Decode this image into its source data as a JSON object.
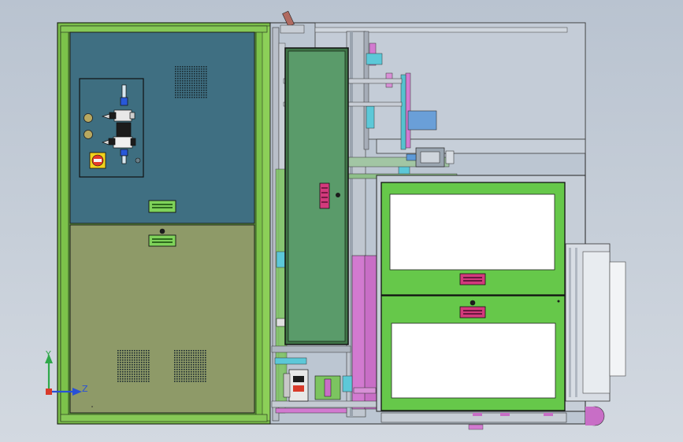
{
  "viewport": {
    "background_top": "#b9c3d0",
    "background_bottom": "#d3d9e1"
  },
  "palette": {
    "frame_green": "#6fb83a",
    "panel_teal": "#3f6f82",
    "panel_khaki": "#8f9a69",
    "door_green": "#5a9b6a",
    "drawer_green": "#66c84a",
    "magenta": "#d27ad0",
    "cyan": "#5cc8d8",
    "steel_blue": "#6a9fd8",
    "outline": "#1c1c1c"
  },
  "coordinate_triad": {
    "y_label": "Y",
    "z_label": "Z",
    "y_color": "#2fa84a",
    "z_color": "#2850d8",
    "x_color": "#d83a2a"
  },
  "parts": {
    "control_panel": "control-panel",
    "mode_selector": "selector-switch-icon"
  }
}
